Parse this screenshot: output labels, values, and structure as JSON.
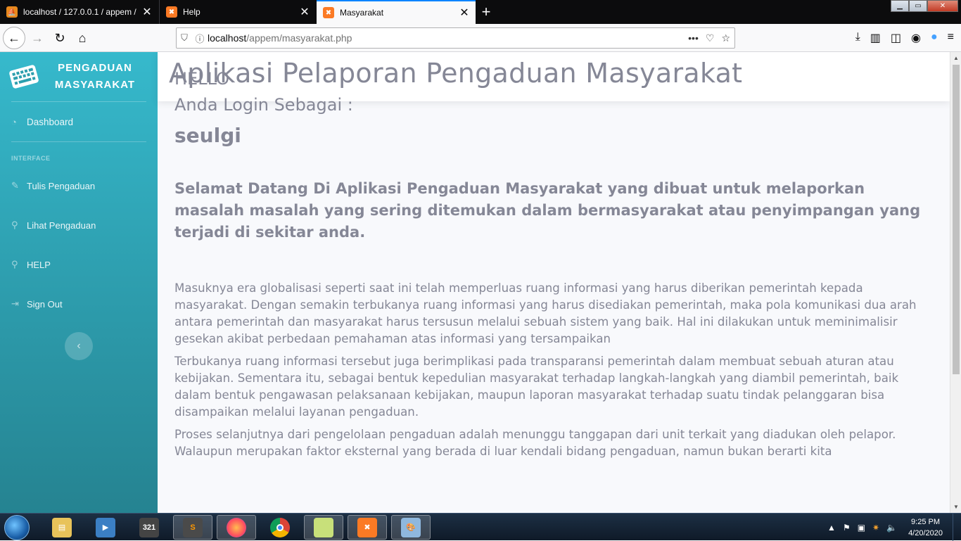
{
  "browser": {
    "tabs": [
      {
        "title": "localhost / 127.0.0.1 / appem / ",
        "icon": "phpmyadmin-icon"
      },
      {
        "title": "Help",
        "icon": "xampp-icon"
      },
      {
        "title": "Masyarakat",
        "icon": "xampp-icon",
        "active": true
      }
    ],
    "url_host": "localhost",
    "url_path": "/appem/masyarakat.php"
  },
  "sidebar": {
    "brand": "PENGADUAN MASYARAKAT",
    "dashboard": "Dashboard",
    "heading": "INTERFACE",
    "items": [
      {
        "label": "Tulis Pengaduan",
        "icon": "edit-icon"
      },
      {
        "label": "Lihat Pengaduan",
        "icon": "search-icon"
      },
      {
        "label": "HELP",
        "icon": "search-icon"
      },
      {
        "label": "Sign Out",
        "icon": "sign-out-icon"
      }
    ]
  },
  "topbar": {
    "title": "Aplikasi Pelaporan Pengaduan Masyarakat"
  },
  "content": {
    "hello": "HELLO",
    "login_as": "Anda Login Sebagai :",
    "username": "seulgi",
    "welcome": "Selamat Datang Di Aplikasi Pengaduan Masyarakat yang dibuat untuk melaporkan masalah masalah yang sering ditemukan dalam bermasyarakat atau penyimpangan yang terjadi di sekitar anda.",
    "paragraphs": [
      "Masuknya era globalisasi seperti saat ini telah memperluas ruang informasi yang harus diberikan pemerintah kepada masyarakat. Dengan semakin terbukanya ruang informasi yang harus disediakan pemerintah, maka pola komunikasi dua arah antara pemerintah dan masyarakat harus tersusun melalui sebuah sistem yang baik. Hal ini dilakukan untuk meminimalisir gesekan akibat perbedaan pemahaman atas informasi yang tersampaikan",
      "Terbukanya ruang informasi tersebut juga berimplikasi pada transparansi pemerintah dalam membuat sebuah aturan atau kebijakan. Sementara itu, sebagai bentuk kepedulian masyarakat terhadap langkah-langkah yang diambil pemerintah, baik dalam bentuk pengawasan pelaksanaan kebijakan, maupun laporan masyarakat terhadap suatu tindak pelanggaran bisa disampaikan melalui layanan pengaduan.",
      "Proses selanjutnya dari pengelolaan pengaduan adalah menunggu tanggapan dari unit terkait yang diadukan oleh pelapor. Walaupun merupakan faktor eksternal yang berada di luar kendali bidang pengaduan, namun bukan berarti kita"
    ]
  },
  "taskbar": {
    "time": "9:25 PM",
    "date": "4/20/2020"
  },
  "colors": {
    "sidebar_top": "#36b9cc",
    "sidebar_bottom": "#258391",
    "text": "#858796"
  }
}
